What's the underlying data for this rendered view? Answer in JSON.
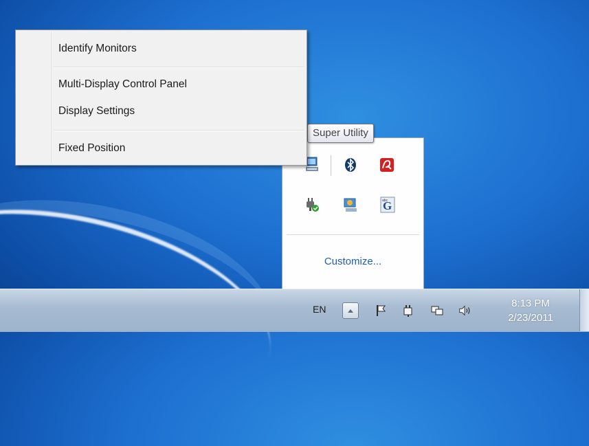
{
  "context_menu": {
    "items": [
      {
        "label": "Identify Monitors"
      },
      {
        "label": "Multi-Display Control Panel"
      },
      {
        "label": "Display Settings"
      },
      {
        "label": "Fixed Position"
      }
    ]
  },
  "tooltip": {
    "text": "Super Utility"
  },
  "tray_popup": {
    "icons": [
      "monitor-utility-icon",
      "bluetooth-icon",
      "antivirus-icon",
      "power-plug-check-icon",
      "network-globe-icon",
      "font-g-icon"
    ],
    "customize_label": "Customize..."
  },
  "taskbar": {
    "language": "EN",
    "icons": [
      "show-hidden-icons-button",
      "action-center-flag-icon",
      "power-icon",
      "network-icon",
      "volume-icon"
    ],
    "time": "8:13 PM",
    "date": "2/23/2011"
  },
  "colors": {
    "wallpaper": "#1d6fd0",
    "menu_bg": "#f1f1f1",
    "link": "#1e5cbf"
  }
}
